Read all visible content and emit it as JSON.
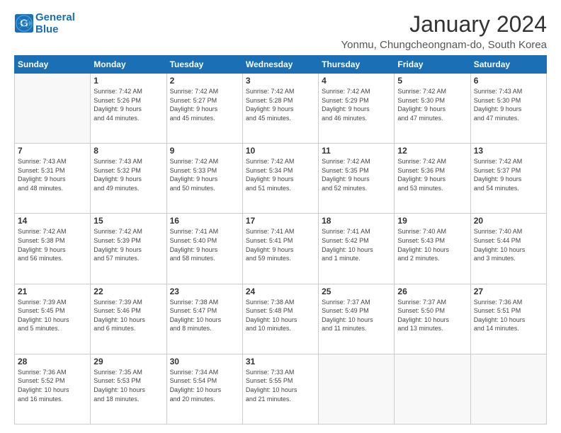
{
  "logo": {
    "line1": "General",
    "line2": "Blue"
  },
  "header": {
    "month": "January 2024",
    "location": "Yonmu, Chungcheongnam-do, South Korea"
  },
  "days_of_week": [
    "Sunday",
    "Monday",
    "Tuesday",
    "Wednesday",
    "Thursday",
    "Friday",
    "Saturday"
  ],
  "weeks": [
    [
      {
        "num": "",
        "empty": true
      },
      {
        "num": "1",
        "sunrise": "7:42 AM",
        "sunset": "5:26 PM",
        "daylight": "9 hours and 44 minutes."
      },
      {
        "num": "2",
        "sunrise": "7:42 AM",
        "sunset": "5:27 PM",
        "daylight": "9 hours and 45 minutes."
      },
      {
        "num": "3",
        "sunrise": "7:42 AM",
        "sunset": "5:28 PM",
        "daylight": "9 hours and 45 minutes."
      },
      {
        "num": "4",
        "sunrise": "7:42 AM",
        "sunset": "5:29 PM",
        "daylight": "9 hours and 46 minutes."
      },
      {
        "num": "5",
        "sunrise": "7:42 AM",
        "sunset": "5:30 PM",
        "daylight": "9 hours and 47 minutes."
      },
      {
        "num": "6",
        "sunrise": "7:43 AM",
        "sunset": "5:30 PM",
        "daylight": "9 hours and 47 minutes."
      }
    ],
    [
      {
        "num": "7",
        "sunrise": "7:43 AM",
        "sunset": "5:31 PM",
        "daylight": "9 hours and 48 minutes."
      },
      {
        "num": "8",
        "sunrise": "7:43 AM",
        "sunset": "5:32 PM",
        "daylight": "9 hours and 49 minutes."
      },
      {
        "num": "9",
        "sunrise": "7:42 AM",
        "sunset": "5:33 PM",
        "daylight": "9 hours and 50 minutes."
      },
      {
        "num": "10",
        "sunrise": "7:42 AM",
        "sunset": "5:34 PM",
        "daylight": "9 hours and 51 minutes."
      },
      {
        "num": "11",
        "sunrise": "7:42 AM",
        "sunset": "5:35 PM",
        "daylight": "9 hours and 52 minutes."
      },
      {
        "num": "12",
        "sunrise": "7:42 AM",
        "sunset": "5:36 PM",
        "daylight": "9 hours and 53 minutes."
      },
      {
        "num": "13",
        "sunrise": "7:42 AM",
        "sunset": "5:37 PM",
        "daylight": "9 hours and 54 minutes."
      }
    ],
    [
      {
        "num": "14",
        "sunrise": "7:42 AM",
        "sunset": "5:38 PM",
        "daylight": "9 hours and 56 minutes."
      },
      {
        "num": "15",
        "sunrise": "7:42 AM",
        "sunset": "5:39 PM",
        "daylight": "9 hours and 57 minutes."
      },
      {
        "num": "16",
        "sunrise": "7:41 AM",
        "sunset": "5:40 PM",
        "daylight": "9 hours and 58 minutes."
      },
      {
        "num": "17",
        "sunrise": "7:41 AM",
        "sunset": "5:41 PM",
        "daylight": "9 hours and 59 minutes."
      },
      {
        "num": "18",
        "sunrise": "7:41 AM",
        "sunset": "5:42 PM",
        "daylight": "10 hours and 1 minute."
      },
      {
        "num": "19",
        "sunrise": "7:40 AM",
        "sunset": "5:43 PM",
        "daylight": "10 hours and 2 minutes."
      },
      {
        "num": "20",
        "sunrise": "7:40 AM",
        "sunset": "5:44 PM",
        "daylight": "10 hours and 3 minutes."
      }
    ],
    [
      {
        "num": "21",
        "sunrise": "7:39 AM",
        "sunset": "5:45 PM",
        "daylight": "10 hours and 5 minutes."
      },
      {
        "num": "22",
        "sunrise": "7:39 AM",
        "sunset": "5:46 PM",
        "daylight": "10 hours and 6 minutes."
      },
      {
        "num": "23",
        "sunrise": "7:38 AM",
        "sunset": "5:47 PM",
        "daylight": "10 hours and 8 minutes."
      },
      {
        "num": "24",
        "sunrise": "7:38 AM",
        "sunset": "5:48 PM",
        "daylight": "10 hours and 10 minutes."
      },
      {
        "num": "25",
        "sunrise": "7:37 AM",
        "sunset": "5:49 PM",
        "daylight": "10 hours and 11 minutes."
      },
      {
        "num": "26",
        "sunrise": "7:37 AM",
        "sunset": "5:50 PM",
        "daylight": "10 hours and 13 minutes."
      },
      {
        "num": "27",
        "sunrise": "7:36 AM",
        "sunset": "5:51 PM",
        "daylight": "10 hours and 14 minutes."
      }
    ],
    [
      {
        "num": "28",
        "sunrise": "7:36 AM",
        "sunset": "5:52 PM",
        "daylight": "10 hours and 16 minutes."
      },
      {
        "num": "29",
        "sunrise": "7:35 AM",
        "sunset": "5:53 PM",
        "daylight": "10 hours and 18 minutes."
      },
      {
        "num": "30",
        "sunrise": "7:34 AM",
        "sunset": "5:54 PM",
        "daylight": "10 hours and 20 minutes."
      },
      {
        "num": "31",
        "sunrise": "7:33 AM",
        "sunset": "5:55 PM",
        "daylight": "10 hours and 21 minutes."
      },
      {
        "num": "",
        "empty": true
      },
      {
        "num": "",
        "empty": true
      },
      {
        "num": "",
        "empty": true
      }
    ]
  ]
}
